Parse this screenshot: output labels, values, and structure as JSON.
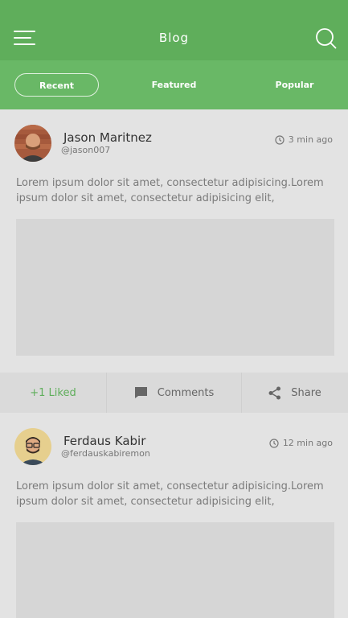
{
  "header": {
    "title": "Blog",
    "menu_icon": "hamburger-menu-icon",
    "search_icon": "search-icon",
    "background": "#5fae5b"
  },
  "tabs": [
    {
      "label": "Recent",
      "active": true
    },
    {
      "label": "Featured",
      "active": false
    },
    {
      "label": "Popular",
      "active": false
    }
  ],
  "posts": [
    {
      "author": "Jason Maritnez",
      "handle": "@jason007",
      "time": "3 min ago",
      "text": "Lorem ipsum dolor sit amet, consectetur adipisicing.Lorem ipsum dolor sit amet, consectetur adipisicing elit,",
      "likes": "+1 Liked",
      "comments": "Comments",
      "share": "Share"
    },
    {
      "author": "Ferdaus Kabir",
      "handle": "@ferdauskabiremon",
      "time": "12 min ago",
      "text": "Lorem ipsum dolor sit amet, consectetur adipisicing.Lorem ipsum dolor sit amet, consectetur adipisicing elit,"
    }
  ],
  "colors": {
    "accent": "#5fae5b",
    "tab_bar": "#69b866",
    "page_bg": "#e3e3e3",
    "media_placeholder": "#d6d6d6"
  },
  "icons": [
    "clock-icon",
    "comment-icon",
    "share-icon"
  ]
}
